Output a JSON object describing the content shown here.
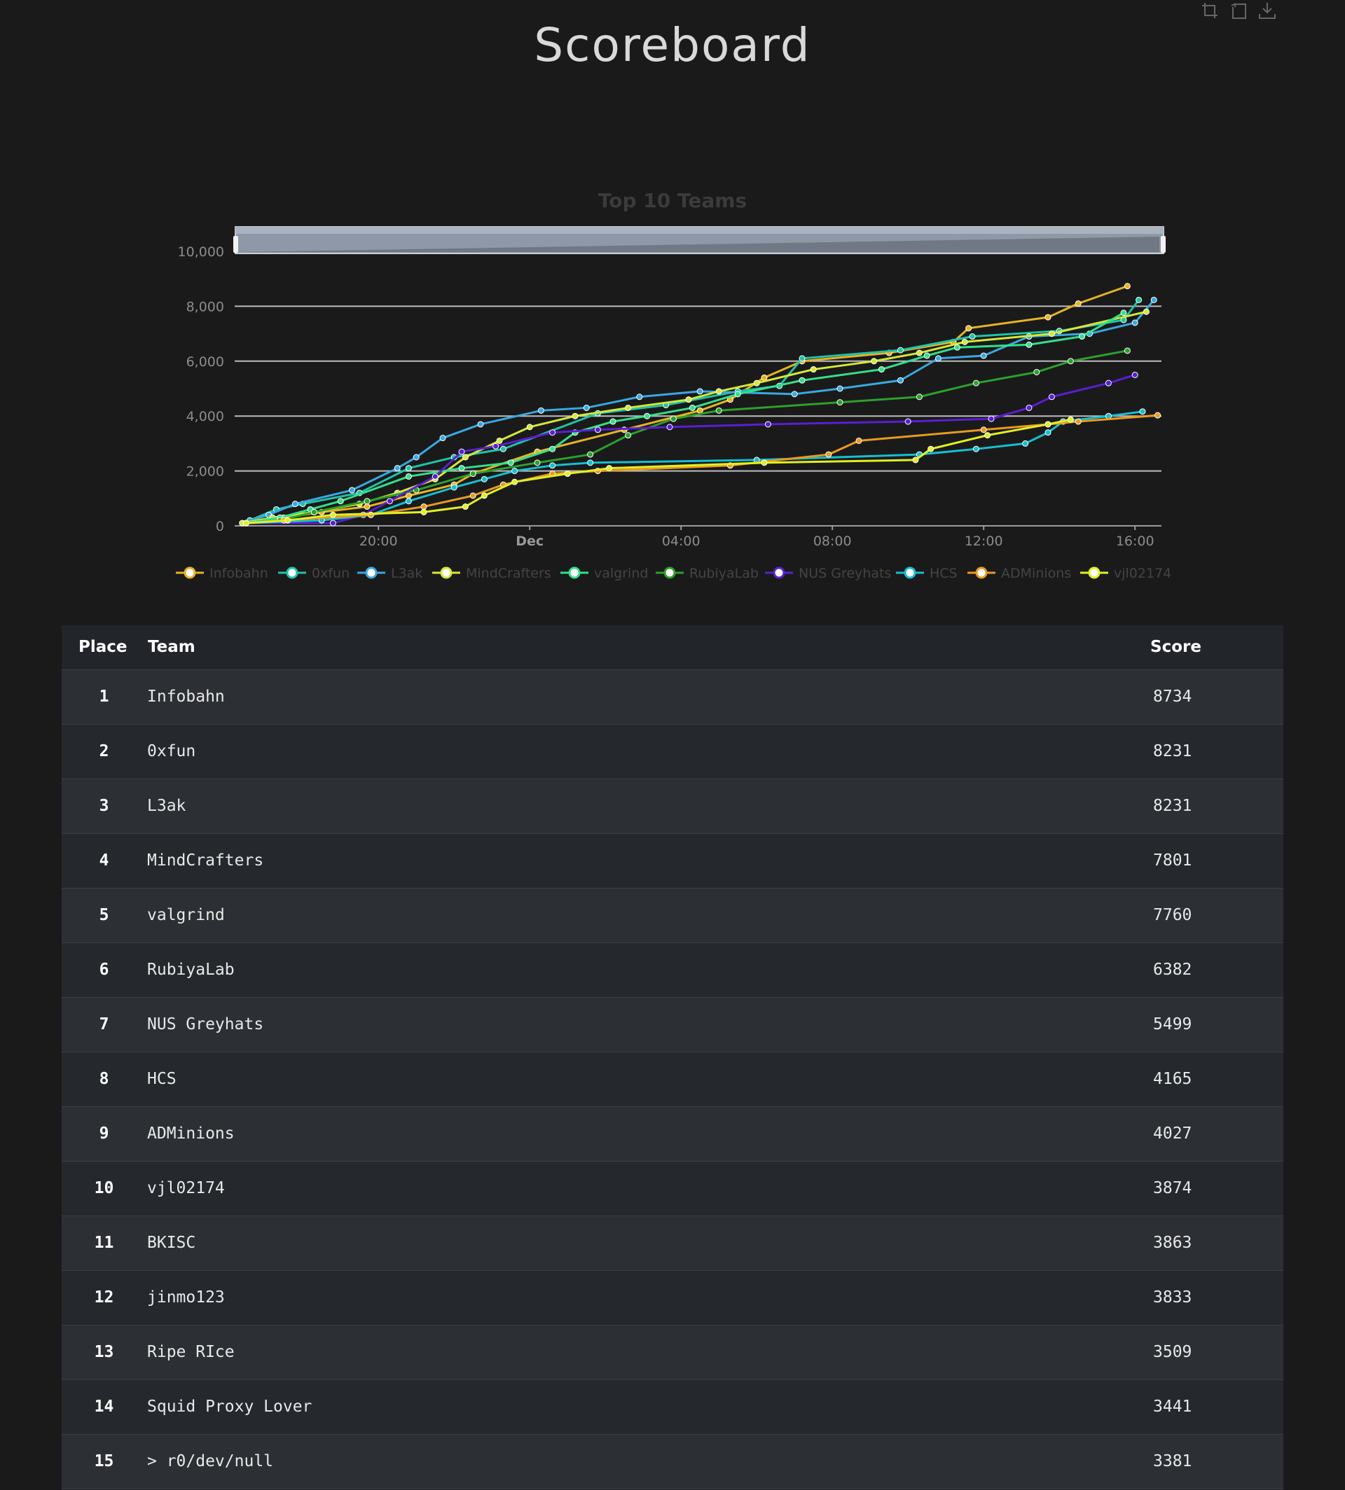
{
  "page": {
    "title": "Scoreboard"
  },
  "toolbar": {
    "icons": [
      "zoom-icon",
      "zoom-reset-icon",
      "save-image-icon"
    ]
  },
  "chart_data": {
    "type": "line",
    "title": "Top 10 Teams",
    "xlabel": "",
    "ylabel": "",
    "x_ticks": [
      "20:00",
      "Dec",
      "04:00",
      "08:00",
      "12:00",
      "16:00"
    ],
    "x_tick_hours": [
      20,
      24,
      28,
      32,
      36,
      40
    ],
    "xlim_hours": [
      16.2,
      40.7
    ],
    "ylim": [
      0,
      10000
    ],
    "y_ticks": [
      "0",
      "2,000",
      "4,000",
      "6,000",
      "8,000",
      "10,000"
    ],
    "y_tick_values": [
      0,
      2000,
      4000,
      6000,
      8000,
      10000
    ],
    "legend_position": "bottom",
    "grid": true,
    "series": [
      {
        "name": "Infobahn",
        "color": "#e6b422",
        "points": [
          [
            16.5,
            100
          ],
          [
            17.5,
            300
          ],
          [
            18.5,
            500
          ],
          [
            19.7,
            700
          ],
          [
            20.8,
            1100
          ],
          [
            22,
            1500
          ],
          [
            22.5,
            1900
          ],
          [
            24.2,
            2700
          ],
          [
            26.5,
            3500
          ],
          [
            28.5,
            4200
          ],
          [
            29.3,
            4600
          ],
          [
            30.2,
            5400
          ],
          [
            31.2,
            6000
          ],
          [
            33.5,
            6300
          ],
          [
            35.2,
            6700
          ],
          [
            35.6,
            7200
          ],
          [
            37.7,
            7600
          ],
          [
            38.5,
            8100
          ],
          [
            39.8,
            8734
          ]
        ]
      },
      {
        "name": "0xfun",
        "color": "#1fc3a8",
        "points": [
          [
            16.6,
            200
          ],
          [
            17.3,
            600
          ],
          [
            18,
            800
          ],
          [
            19.5,
            1200
          ],
          [
            20.8,
            2100
          ],
          [
            22,
            2500
          ],
          [
            23.3,
            2800
          ],
          [
            25.8,
            4100
          ],
          [
            27.6,
            4400
          ],
          [
            29.5,
            4900
          ],
          [
            30.6,
            5100
          ],
          [
            31.2,
            6100
          ],
          [
            33.8,
            6400
          ],
          [
            35.7,
            6900
          ],
          [
            38,
            7100
          ],
          [
            39.7,
            7500
          ],
          [
            40.1,
            8231
          ]
        ]
      },
      {
        "name": "L3ak",
        "color": "#3aa8e0",
        "points": [
          [
            16.4,
            100
          ],
          [
            17.1,
            400
          ],
          [
            17.8,
            800
          ],
          [
            19.3,
            1300
          ],
          [
            20.5,
            2100
          ],
          [
            21,
            2500
          ],
          [
            21.7,
            3200
          ],
          [
            22.7,
            3700
          ],
          [
            24.3,
            4200
          ],
          [
            25.5,
            4300
          ],
          [
            26.9,
            4700
          ],
          [
            28.5,
            4900
          ],
          [
            31,
            4800
          ],
          [
            32.2,
            5000
          ],
          [
            33.8,
            5300
          ],
          [
            34.8,
            6100
          ],
          [
            36,
            6200
          ],
          [
            37.2,
            6900
          ],
          [
            38.8,
            7000
          ],
          [
            40,
            7400
          ],
          [
            40.5,
            8231
          ]
        ]
      },
      {
        "name": "MindCrafters",
        "color": "#d4e837",
        "points": [
          [
            16.4,
            100
          ],
          [
            17.2,
            300
          ],
          [
            18.3,
            500
          ],
          [
            19.5,
            800
          ],
          [
            20.5,
            1200
          ],
          [
            21.5,
            1700
          ],
          [
            22.3,
            2500
          ],
          [
            23.2,
            3100
          ],
          [
            24,
            3600
          ],
          [
            25.2,
            4000
          ],
          [
            26.6,
            4300
          ],
          [
            28.2,
            4600
          ],
          [
            29,
            4900
          ],
          [
            30,
            5200
          ],
          [
            31.5,
            5700
          ],
          [
            33.1,
            6000
          ],
          [
            34.3,
            6300
          ],
          [
            35.5,
            6700
          ],
          [
            37.8,
            7000
          ],
          [
            40.3,
            7801
          ]
        ]
      },
      {
        "name": "valgrind",
        "color": "#33e08a",
        "points": [
          [
            16.5,
            100
          ],
          [
            17.4,
            300
          ],
          [
            18.2,
            600
          ],
          [
            19,
            900
          ],
          [
            20.8,
            1800
          ],
          [
            22.2,
            2100
          ],
          [
            23.5,
            2300
          ],
          [
            24.6,
            2800
          ],
          [
            25.2,
            3400
          ],
          [
            26.2,
            3800
          ],
          [
            27.1,
            4000
          ],
          [
            28.3,
            4300
          ],
          [
            29.5,
            4800
          ],
          [
            31.2,
            5300
          ],
          [
            33.3,
            5700
          ],
          [
            34.5,
            6200
          ],
          [
            35.3,
            6500
          ],
          [
            37.2,
            6600
          ],
          [
            38.6,
            6900
          ],
          [
            39.7,
            7760
          ]
        ]
      },
      {
        "name": "RubiyaLab",
        "color": "#2ca02c",
        "points": [
          [
            16.5,
            100
          ],
          [
            17.4,
            200
          ],
          [
            18.3,
            500
          ],
          [
            19.7,
            900
          ],
          [
            21,
            1300
          ],
          [
            22.5,
            1900
          ],
          [
            24.2,
            2300
          ],
          [
            25.6,
            2600
          ],
          [
            26.6,
            3300
          ],
          [
            27.8,
            3900
          ],
          [
            29,
            4200
          ],
          [
            32.2,
            4500
          ],
          [
            34.3,
            4700
          ],
          [
            35.8,
            5200
          ],
          [
            37.4,
            5600
          ],
          [
            38.3,
            6000
          ],
          [
            39.8,
            6382
          ]
        ]
      },
      {
        "name": "NUS Greyhats",
        "color": "#5a1fd1",
        "points": [
          [
            16.5,
            100
          ],
          [
            18.8,
            100
          ],
          [
            19.6,
            400
          ],
          [
            20.3,
            900
          ],
          [
            21.5,
            1800
          ],
          [
            22.2,
            2700
          ],
          [
            23.1,
            2900
          ],
          [
            24.6,
            3400
          ],
          [
            25.8,
            3500
          ],
          [
            27.7,
            3600
          ],
          [
            30.3,
            3700
          ],
          [
            34,
            3800
          ],
          [
            36.2,
            3900
          ],
          [
            37.2,
            4300
          ],
          [
            37.8,
            4700
          ],
          [
            39.3,
            5200
          ],
          [
            40,
            5499
          ]
        ]
      },
      {
        "name": "HCS",
        "color": "#17becf",
        "points": [
          [
            16.5,
            100
          ],
          [
            18.5,
            200
          ],
          [
            19.8,
            400
          ],
          [
            20.8,
            900
          ],
          [
            22,
            1400
          ],
          [
            22.8,
            1700
          ],
          [
            23.6,
            2000
          ],
          [
            24.6,
            2200
          ],
          [
            25.6,
            2300
          ],
          [
            30,
            2400
          ],
          [
            34.3,
            2600
          ],
          [
            35.8,
            2800
          ],
          [
            37.1,
            3000
          ],
          [
            37.7,
            3400
          ],
          [
            38.1,
            3800
          ],
          [
            39.3,
            4000
          ],
          [
            40.2,
            4165
          ]
        ]
      },
      {
        "name": "ADMinions",
        "color": "#e89b20",
        "points": [
          [
            16.5,
            100
          ],
          [
            17.5,
            200
          ],
          [
            19.8,
            400
          ],
          [
            21.2,
            700
          ],
          [
            22.5,
            1100
          ],
          [
            23.3,
            1500
          ],
          [
            24.6,
            1900
          ],
          [
            25.8,
            2000
          ],
          [
            29.3,
            2200
          ],
          [
            31.9,
            2600
          ],
          [
            32.7,
            3100
          ],
          [
            36,
            3500
          ],
          [
            37.7,
            3700
          ],
          [
            38.5,
            3800
          ],
          [
            40.6,
            4027
          ]
        ]
      },
      {
        "name": "vjl02174",
        "color": "#e0f022",
        "points": [
          [
            16.5,
            100
          ],
          [
            17.6,
            200
          ],
          [
            18.8,
            400
          ],
          [
            21.2,
            500
          ],
          [
            22.3,
            700
          ],
          [
            22.8,
            1100
          ],
          [
            23.6,
            1600
          ],
          [
            25,
            1900
          ],
          [
            26.1,
            2100
          ],
          [
            30.2,
            2300
          ],
          [
            34.2,
            2400
          ],
          [
            34.6,
            2800
          ],
          [
            36.1,
            3300
          ],
          [
            37.7,
            3700
          ],
          [
            38.3,
            3874
          ]
        ]
      }
    ]
  },
  "table": {
    "headers": {
      "place": "Place",
      "team": "Team",
      "score": "Score"
    },
    "rows": [
      {
        "place": "1",
        "team": "Infobahn",
        "score": "8734"
      },
      {
        "place": "2",
        "team": "0xfun",
        "score": "8231"
      },
      {
        "place": "3",
        "team": "L3ak",
        "score": "8231"
      },
      {
        "place": "4",
        "team": "MindCrafters",
        "score": "7801"
      },
      {
        "place": "5",
        "team": "valgrind",
        "score": "7760"
      },
      {
        "place": "6",
        "team": "RubiyaLab",
        "score": "6382"
      },
      {
        "place": "7",
        "team": "NUS Greyhats",
        "score": "5499"
      },
      {
        "place": "8",
        "team": "HCS",
        "score": "4165"
      },
      {
        "place": "9",
        "team": "ADMinions",
        "score": "4027"
      },
      {
        "place": "10",
        "team": "vjl02174",
        "score": "3874"
      },
      {
        "place": "11",
        "team": "BKISC",
        "score": "3863"
      },
      {
        "place": "12",
        "team": "jinmo123",
        "score": "3833"
      },
      {
        "place": "13",
        "team": "Ripe RIce",
        "score": "3509"
      },
      {
        "place": "14",
        "team": "Squid Proxy Lover",
        "score": "3441"
      },
      {
        "place": "15",
        "team": "> r0/dev/null",
        "score": "3381"
      }
    ]
  }
}
